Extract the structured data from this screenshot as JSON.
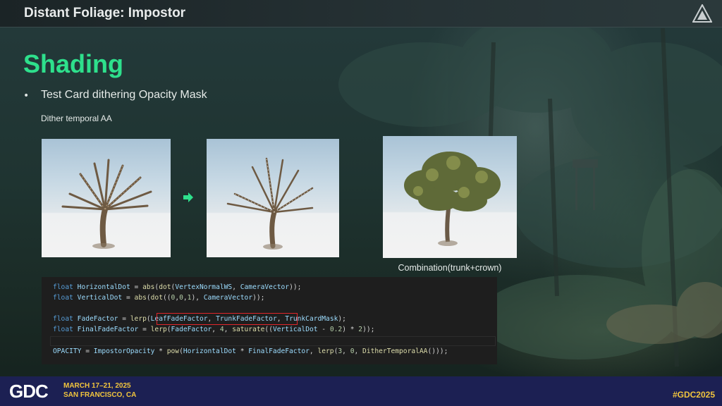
{
  "header": {
    "title": "Distant Foliage: Impostor",
    "logo_icon": "triangle-logo-icon"
  },
  "slide": {
    "title": "Shading",
    "bullet": "Test Card dithering Opacity Mask",
    "sublabel": "Dither temporal AA",
    "caption_combination": "Combination(trunk+crown)",
    "arrow_icon": "arrow-right-icon"
  },
  "code": {
    "lines": [
      [
        "float",
        " HorizontalDot = ",
        "abs",
        "(",
        "dot",
        "(VertexNormalWS, CameraVector));"
      ],
      [
        "float",
        " VerticalDot = ",
        "abs",
        "(",
        "dot",
        "((0,0,1), CameraVector));"
      ]
    ],
    "line1": "float HorizontalDot = abs(dot(VertexNormalWS, CameraVector));",
    "line2": "float VerticalDot = abs(dot((0,0,1), CameraVector));",
    "line3": "float FadeFactor = lerp(LeafFadeFactor, TrunkFadeFactor, TrunkCardMask);",
    "line4": "float FinalFadeFactor = lerp(FadeFactor, 4, saturate((VerticalDot - 0.2) * 2));",
    "line5": "OPACITY = ImpostorOpacity * pow(HorizontalDot * FinalFadeFactor, lerp(3, 0, DitherTemporalAA()));"
  },
  "footer": {
    "logo": "GDC",
    "date": "MARCH 17–21, 2025",
    "place": "SAN FRANCISCO, CA",
    "hashtag": "#GDC2025"
  },
  "colors": {
    "accent_green": "#2ee08c",
    "footer_bg": "#1c2053",
    "gdc_yellow": "#f2c53d",
    "highlight_red": "#e0262b"
  }
}
